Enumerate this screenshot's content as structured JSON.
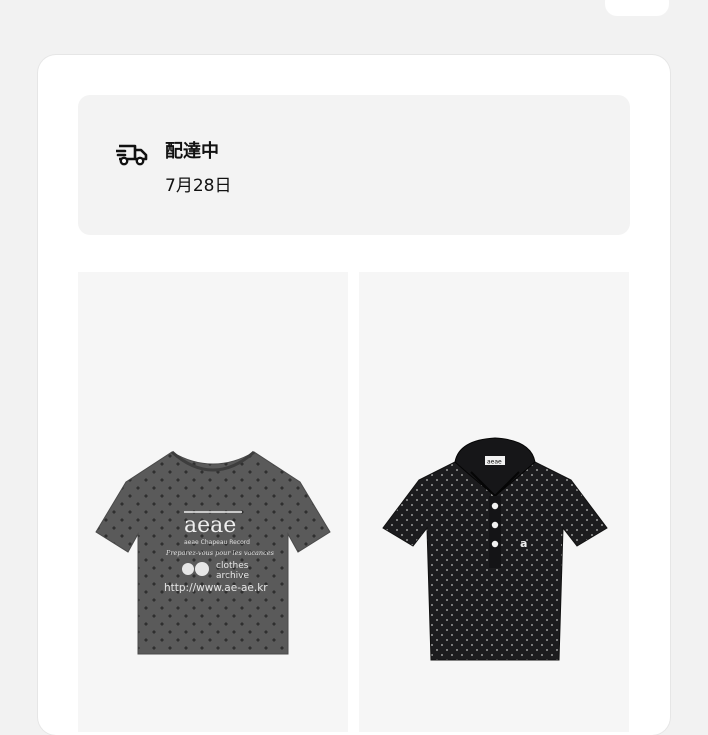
{
  "delivery": {
    "status": "配達中",
    "date": "7月28日",
    "icon": "delivery-truck-icon"
  },
  "products": [
    {
      "name": "grey-polka-dot-tshirt",
      "color": "#5a5a5a",
      "print": {
        "logo": "aeae",
        "line1": "aeae  Chapeau Record",
        "line2": "Preparez-vous pour les vacances",
        "line3a": "clothes",
        "line3b": "archive",
        "url": "http://www.ae-ae.kr"
      }
    },
    {
      "name": "black-polka-dot-polo",
      "color": "#1c1c1e",
      "tag": "aeae",
      "badge": "a"
    }
  ]
}
